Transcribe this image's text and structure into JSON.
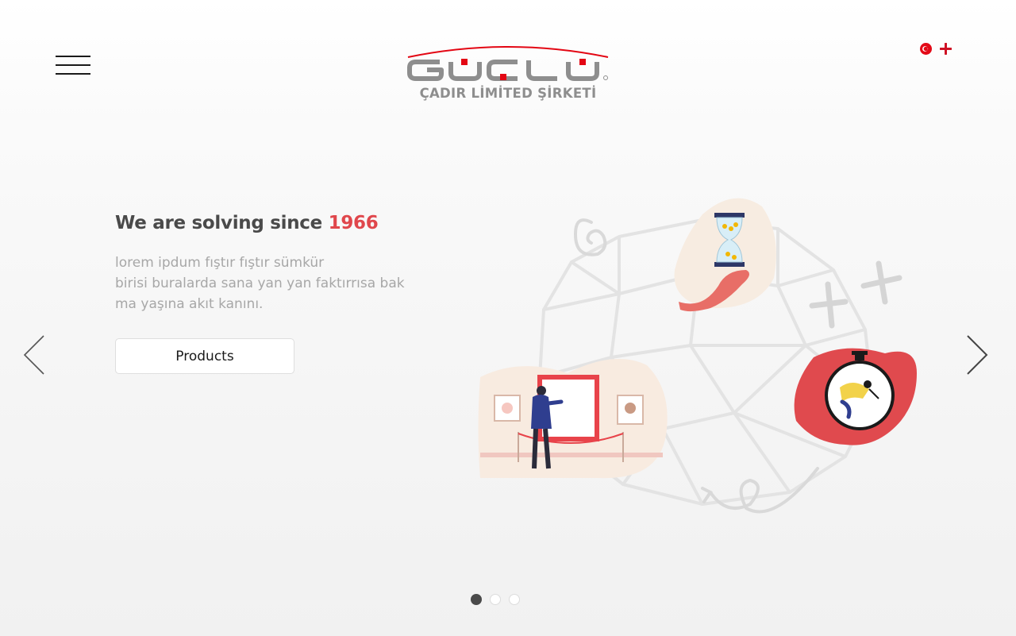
{
  "header": {
    "menu_icon": "hamburger-menu-icon",
    "logo_text": "GÜÇLÜ",
    "logo_subtitle": "ÇADIR LİMİTED ŞİRKETİ",
    "languages": [
      {
        "code": "tr",
        "icon": "turkey-flag-icon"
      },
      {
        "code": "en",
        "icon": "england-flag-icon"
      }
    ],
    "brand_color": "#e30613"
  },
  "hero": {
    "title_prefix": "We are solving since ",
    "title_year": "1966",
    "lines": [
      "lorem ipdum fıştır fıştır sümkür",
      "birisi buralarda sana yan yan faktırrısa bak",
      "ma yaşına akıt kanını."
    ],
    "button_label": "Products",
    "accent_color": "#e0474c"
  },
  "carousel": {
    "prev_icon": "chevron-left-icon",
    "next_icon": "chevron-right-icon",
    "slide_count": 3,
    "active_index": 0
  }
}
